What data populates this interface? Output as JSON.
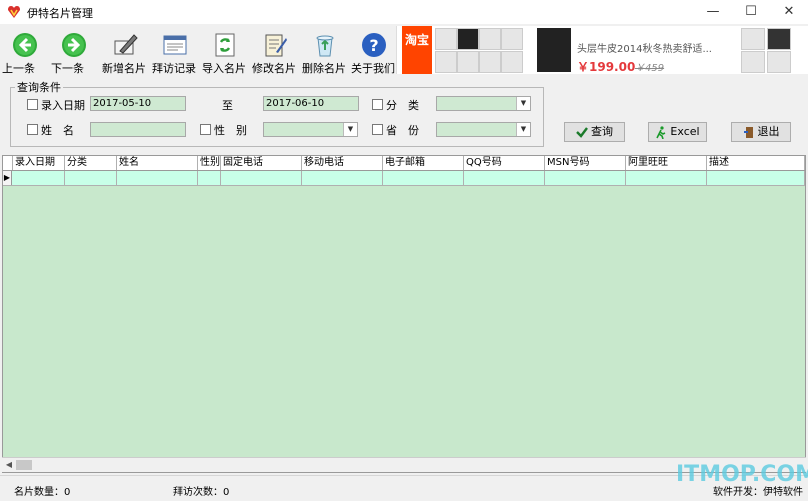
{
  "window": {
    "title": "伊特名片管理",
    "controls": [
      "—",
      "☐",
      "✕"
    ]
  },
  "toolbar": {
    "items": [
      {
        "label": "上一条",
        "icon": "arrow-left-icon"
      },
      {
        "label": "下一条",
        "icon": "arrow-right-icon"
      },
      {
        "label": "新增名片",
        "icon": "pen-card-icon"
      },
      {
        "label": "拜访记录",
        "icon": "record-icon"
      },
      {
        "label": "导入名片",
        "icon": "import-refresh-icon"
      },
      {
        "label": "修改名片",
        "icon": "edit-notebook-icon"
      },
      {
        "label": "删除名片",
        "icon": "recycle-bin-icon"
      },
      {
        "label": "关于我们",
        "icon": "help-icon"
      }
    ]
  },
  "ad": {
    "logo_text": "淘宝",
    "product_title": "头层牛皮2014秋冬热卖舒适...",
    "price": "￥199.00",
    "old_price": "￥459"
  },
  "query": {
    "legend": "查询条件",
    "date_label": "录入日期",
    "date_from": "2017-05-10",
    "to_label": "至",
    "date_to": "2017-06-10",
    "category_label": "分　类",
    "name_label": "姓　名",
    "gender_label": "性　别",
    "province_label": "省　份"
  },
  "buttons": {
    "search": "查询",
    "excel": "Excel",
    "exit": "退出"
  },
  "grid": {
    "columns": [
      "录入日期",
      "分类",
      "姓名",
      "性别",
      "固定电话",
      "移动电话",
      "电子邮箱",
      "QQ号码",
      "MSN号码",
      "阿里旺旺",
      "描述"
    ]
  },
  "status": {
    "card_count": "名片数量：0",
    "visit_count": "拜访次数：0",
    "developer": "软件开发：伊特软件"
  },
  "watermark": "ITMOP.COM",
  "colors": {
    "field_bg": "#cfe9d2",
    "grid_bg": "#c8e8cc",
    "row_bg": "#c8ffe8",
    "price": "#e4393c"
  }
}
